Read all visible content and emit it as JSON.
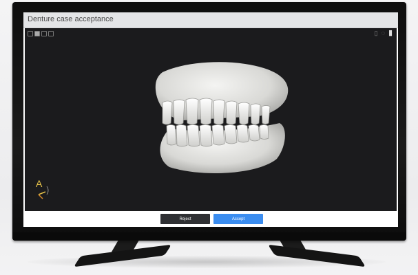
{
  "window": {
    "title": "Denture case acceptance"
  },
  "viewer": {
    "left_toolbar_icons": [
      "view-icon",
      "solid-icon",
      "wire-icon",
      "grid-icon"
    ],
    "right_toolbar_icons": [
      "ortho-icon",
      "lighting-icon",
      "cursor-icon"
    ],
    "orientation_widget": {
      "letter": "A",
      "icon": "axis-gizmo-icon"
    }
  },
  "actions": {
    "reject_label": "Reject",
    "accept_label": "Accept"
  },
  "colors": {
    "accept": "#3b8df0",
    "reject": "#2f3033",
    "viewer_bg": "#1b1b1d",
    "titlebar": "#e4e5e7"
  }
}
